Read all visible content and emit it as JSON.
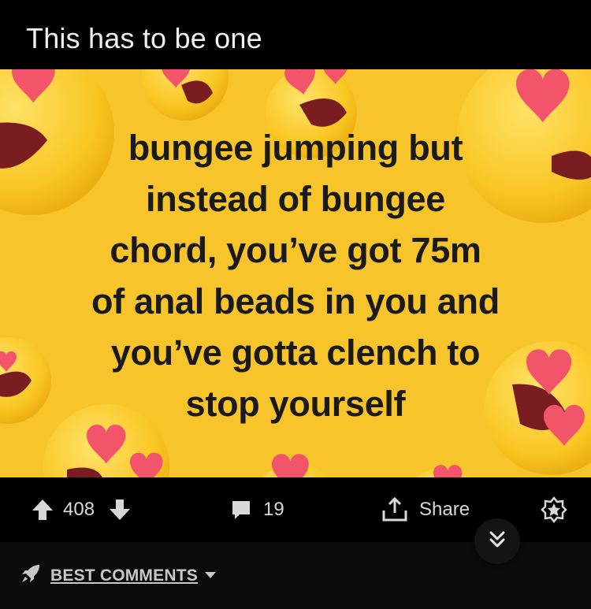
{
  "post": {
    "title": "This has to be one"
  },
  "meme": {
    "lines": [
      "bungee jumping but",
      "instead of bungee",
      "chord, you’ve got 75m",
      "of anal beads in you and",
      "you’ve gotta clench to",
      "stop yourself"
    ],
    "background_color": "#f8c42b",
    "decoration": "heart-eyes-emoji"
  },
  "actions": {
    "upvote_count": "408",
    "comment_count": "19",
    "share_label": "Share",
    "icons": [
      "upvote-icon",
      "downvote-icon",
      "comment-icon",
      "share-icon",
      "award-icon",
      "double-chevron-down-icon"
    ]
  },
  "comments": {
    "sort_label": "BEST COMMENTS",
    "sort_icon": "rocket-icon"
  },
  "colors": {
    "background": "#000000",
    "text": "#d8d8d8",
    "meme_yellow": "#f8c42b",
    "heart_pink": "#f2546a"
  }
}
